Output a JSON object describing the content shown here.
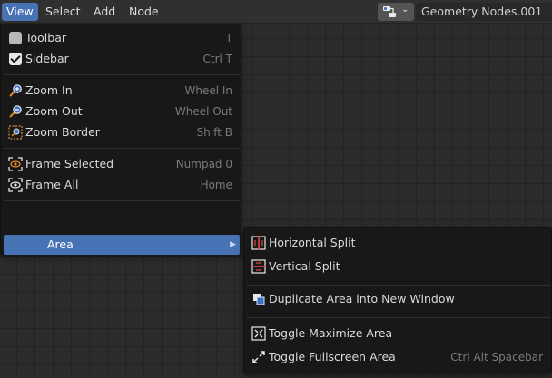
{
  "header": {
    "menus": [
      "View",
      "Select",
      "Add",
      "Node"
    ],
    "active_menu": "View",
    "editor_type_icon": "node-editor-icon",
    "node_tree_name": "Geometry Nodes.001"
  },
  "view_menu": {
    "items": [
      {
        "label": "Toolbar",
        "shortcut": "T",
        "icon": "checkbox-off"
      },
      {
        "label": "Sidebar",
        "shortcut": "Ctrl T",
        "icon": "checkbox-on"
      },
      {
        "label": "Zoom In",
        "shortcut": "Wheel In",
        "icon": "zoom-in-icon"
      },
      {
        "label": "Zoom Out",
        "shortcut": "Wheel Out",
        "icon": "zoom-out-icon"
      },
      {
        "label": "Zoom Border",
        "shortcut": "Shift B",
        "icon": "zoom-border-icon"
      },
      {
        "label": "Frame Selected",
        "shortcut": "Numpad 0",
        "icon": "frame-selected-icon"
      },
      {
        "label": "Frame All",
        "shortcut": "Home",
        "icon": "frame-all-icon"
      },
      {
        "label": "Area",
        "shortcut": "",
        "icon": "none"
      }
    ]
  },
  "area_menu": {
    "items": [
      {
        "label": "Horizontal Split",
        "shortcut": "",
        "icon": "horizontal-split-icon"
      },
      {
        "label": "Vertical Split",
        "shortcut": "",
        "icon": "vertical-split-icon"
      },
      {
        "label": "Duplicate Area into New Window",
        "shortcut": "",
        "icon": "duplicate-window-icon"
      },
      {
        "label": "Toggle Maximize Area",
        "shortcut": "",
        "icon": "maximize-area-icon"
      },
      {
        "label": "Toggle Fullscreen Area",
        "shortcut": "Ctrl Alt Spacebar",
        "icon": "fullscreen-icon"
      }
    ]
  },
  "colors": {
    "accent": "#4772b3",
    "menu_bg": "#181818",
    "header_bg": "#303030",
    "canvas_bg": "#2b2b2b",
    "split_icon_red": "#e04848"
  }
}
